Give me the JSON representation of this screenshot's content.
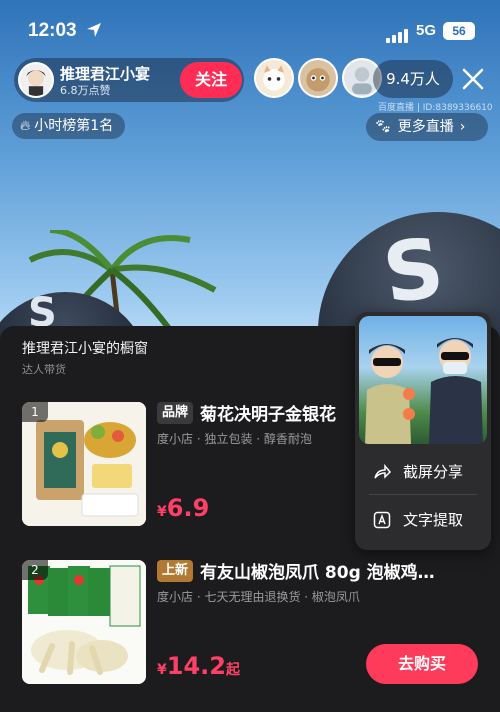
{
  "status_bar": {
    "time": "12:03",
    "network": "5G",
    "battery": "56"
  },
  "host": {
    "name": "推理君江小宴",
    "likes": "6.8万点赞",
    "follow_label": "关注"
  },
  "viewers": {
    "count": "9.4万人",
    "room_id": "百度直播 | ID:8389336610"
  },
  "rank_badge": "小时榜第1名",
  "more_live_label": "更多直播",
  "panel": {
    "title": "推理君江小宴的橱窗",
    "subtitle": "达人带货",
    "items": [
      {
        "index": "1",
        "tag": "品牌",
        "title": "菊花决明子金银花",
        "meta": "度小店 · 独立包装 · 醇香耐泡",
        "price_symbol": "¥",
        "price": "6.9",
        "price_suffix": ""
      },
      {
        "index": "2",
        "tag": "上新",
        "title": "有友山椒泡凤爪 80g 泡椒鸡…",
        "meta": "度小店 · 七天无理由退换货 · 椒泡凤爪",
        "price_symbol": "¥",
        "price": "14.2",
        "price_suffix": "起",
        "buy_label": "去购买"
      }
    ]
  },
  "popup": {
    "share_label": "截屏分享",
    "ocr_label": "文字提取"
  },
  "colors": {
    "accent": "#ff2d55",
    "price": "#ff4066",
    "panel": "#1c1c1e"
  }
}
